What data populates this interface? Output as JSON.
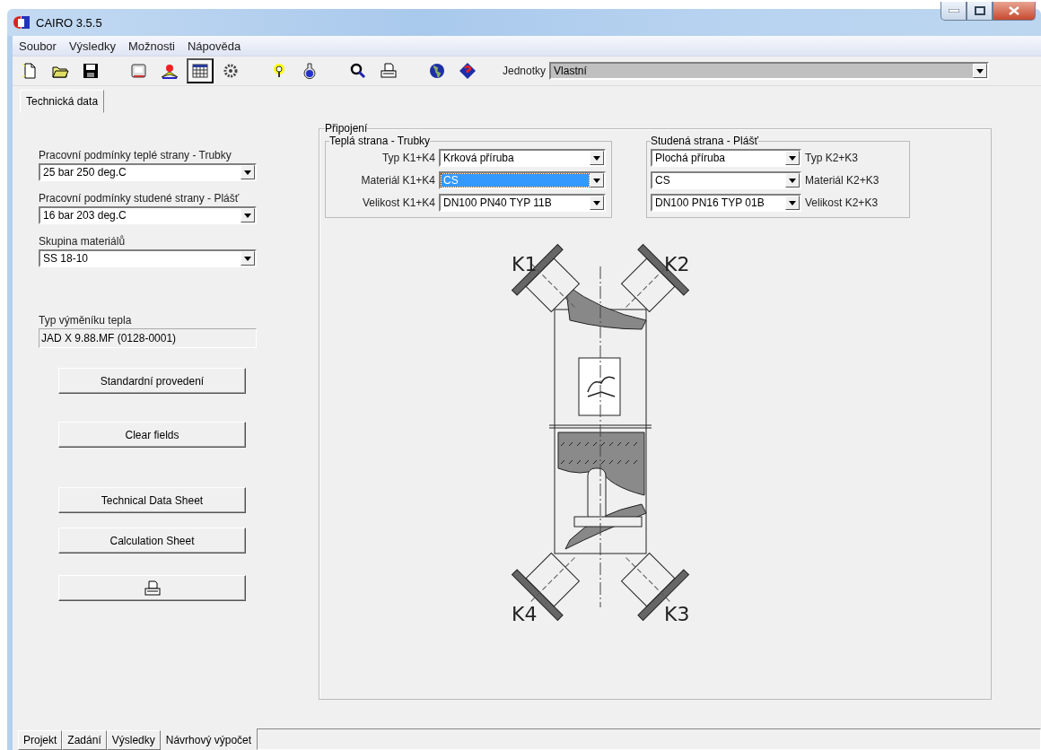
{
  "window": {
    "title": "CAIRO 3.5.5"
  },
  "menu": [
    "Soubor",
    "Výsledky",
    "Možnosti",
    "Nápověda"
  ],
  "toolbar": {
    "groups": [
      [
        {
          "kind": "new",
          "pressed": false
        },
        {
          "kind": "open",
          "pressed": false
        },
        {
          "kind": "save",
          "pressed": false
        }
      ],
      [
        {
          "kind": "notes",
          "pressed": false
        },
        {
          "kind": "helpbook",
          "pressed": false
        },
        {
          "kind": "table",
          "pressed": true
        },
        {
          "kind": "gear",
          "pressed": false
        }
      ],
      [
        {
          "kind": "bulb",
          "pressed": false
        },
        {
          "kind": "flask",
          "pressed": false
        }
      ],
      [
        {
          "kind": "search",
          "pressed": false
        },
        {
          "kind": "print",
          "pressed": false
        }
      ],
      [
        {
          "kind": "globe",
          "pressed": false
        },
        {
          "kind": "help",
          "pressed": false
        }
      ]
    ],
    "units": {
      "label": "Jednotky",
      "value": "Vlastní",
      "disabled": true
    }
  },
  "top_tab": "Technická data",
  "left_panel": {
    "fields": [
      {
        "label": "Pracovní podmínky teplé strany - Trubky",
        "value": "25 bar 250 deg.C"
      },
      {
        "label": "Pracovní podmínky studené strany - Plášť",
        "value": "16 bar 203 deg.C"
      },
      {
        "label": "Skupina materiálů",
        "value": "SS 18-10"
      }
    ],
    "exchanger_type": {
      "label": "Typ výměníku tepla",
      "value": "JAD X 9.88.MF (0128-0001)"
    },
    "buttons": [
      {
        "kind": "text",
        "label": "Standardní provedení"
      },
      {
        "kind": "text",
        "label": "Clear fields"
      },
      {
        "kind": "text",
        "label": "Technical Data Sheet"
      },
      {
        "kind": "text",
        "label": "Calculation Sheet"
      },
      {
        "kind": "print"
      }
    ]
  },
  "connection": {
    "title": "Připojení",
    "hot_side": {
      "title": "Teplá strana - Trubky",
      "rows": [
        {
          "label": "Typ K1+K4",
          "value": "Krková příruba",
          "focused": false
        },
        {
          "label": "Materiál K1+K4",
          "value": "CS",
          "focused": true
        },
        {
          "label": "Velikost K1+K4",
          "value": "DN100 PN40 TYP 11B",
          "focused": false
        }
      ]
    },
    "cold_side": {
      "title": "Studená strana - Plášť",
      "rows": [
        {
          "label": "Typ K2+K3",
          "value": "Plochá příruba",
          "focused": false
        },
        {
          "label": "Materiál K2+K3",
          "value": "CS",
          "focused": false
        },
        {
          "label": "Velikost K2+K3",
          "value": "DN100 PN16 TYP 01B",
          "focused": false
        }
      ]
    },
    "diagram_labels": [
      "K1",
      "K2",
      "K4",
      "K3"
    ]
  },
  "bottom_tabs": [
    {
      "label": "Projekt",
      "selected": false
    },
    {
      "label": "Zadání",
      "selected": false
    },
    {
      "label": "Výsledky",
      "selected": false
    },
    {
      "label": "Návrhový výpočet",
      "selected": true
    }
  ]
}
